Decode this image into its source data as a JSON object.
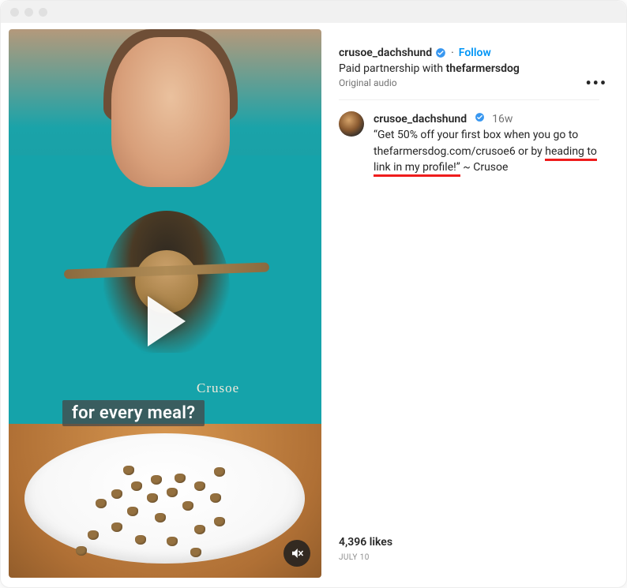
{
  "header": {
    "username": "crusoe_dachshund",
    "follow_label": "Follow",
    "separator": "·",
    "paid_prefix": "Paid partnership with ",
    "partner": "thefarmersdog",
    "audio_label": "Original audio"
  },
  "comment": {
    "username": "crusoe_dachshund",
    "time_ago": "16w",
    "body_before": "“Get 50% off your first box when you go to thefarmersdog.com/crusoe6 or by ",
    "body_underlined": "heading to link in my profile!”",
    "body_after": " ~ Crusoe"
  },
  "media": {
    "caption_overlay": "for every meal?",
    "dog_print_label": "Crusoe"
  },
  "footer": {
    "likes_text": "4,396 likes",
    "date_text": "July 10"
  },
  "icons": {
    "verified": "verified-badge-icon",
    "more": "more-options-icon",
    "play": "play-icon",
    "mute": "audio-muted-icon"
  }
}
